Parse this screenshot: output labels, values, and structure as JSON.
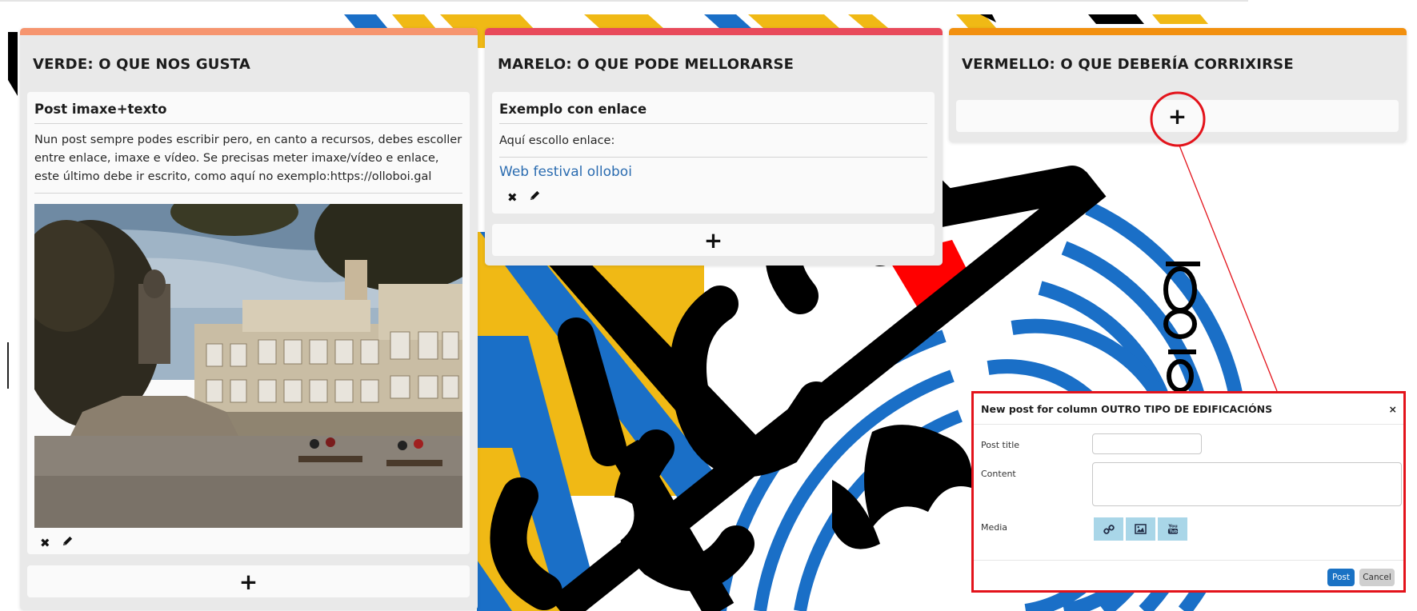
{
  "columns": [
    {
      "title": "VERDE: O QUE NOS GUSTA",
      "accent": "#f6956f",
      "card": {
        "title": "Post imaxe+texto",
        "text": "Nun post sempre podes escribir pero, en canto a recursos, debes escoller entre enlace, imaxe e vídeo. Se precisas meter imaxe/vídeo e enlace, este último debe ir escrito, como aquí no exemplo:https://olloboi.gal",
        "image": "town-square-photo"
      },
      "add_label": "+"
    },
    {
      "title": "MARELO: O QUE PODE MELLORARSE",
      "accent": "#e84a5b",
      "card": {
        "title": "Exemplo con enlace",
        "text": "Aquí escollo enlace:",
        "link": "Web festival olloboi"
      },
      "add_label": "+"
    },
    {
      "title": "VERMELLO: O QUE DEBERÍA CORRIXIRSE",
      "accent": "#f2900f",
      "add_label": "+"
    }
  ],
  "icons": {
    "delete": "✖",
    "edit": "pencil-icon"
  },
  "modal": {
    "title": "New post for column OUTRO TIPO DE EDIFICACIÓNS",
    "close": "×",
    "post_title_label": "Post title",
    "content_label": "Content",
    "media_label": "Media",
    "media_options": [
      "link-icon",
      "image-icon",
      "youtube-icon"
    ],
    "post_button": "Post",
    "cancel_button": "Cancel"
  },
  "colors": {
    "highlight": "#e3131b",
    "post_button": "#1a72c4",
    "cancel_button": "#cfcfcf",
    "media_button": "#a9d6e8",
    "bg_yellow": "#f0b915",
    "bg_blue": "#1a6fc7",
    "bg_red": "#ff0000"
  }
}
